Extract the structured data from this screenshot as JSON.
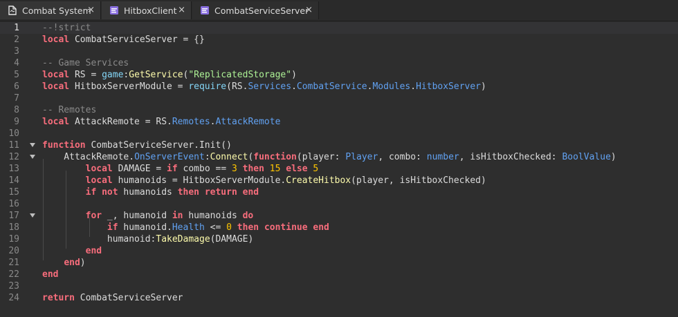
{
  "tabs": [
    {
      "label": "Combat System",
      "icon": "document-icon",
      "active": false,
      "close": "×"
    },
    {
      "label": "HitboxClient",
      "icon": "local-script-icon",
      "active": false,
      "close": "×"
    },
    {
      "label": "CombatServiceServer",
      "icon": "module-script-icon",
      "active": true,
      "close": "×"
    }
  ],
  "editor": {
    "current_line": 1,
    "lines": [
      {
        "n": "1",
        "tokens": [
          [
            "cm",
            "--!strict"
          ]
        ]
      },
      {
        "n": "2",
        "tokens": [
          [
            "kw",
            "local"
          ],
          [
            "",
            " CombatServiceServer = {}"
          ]
        ]
      },
      {
        "n": "3",
        "tokens": []
      },
      {
        "n": "4",
        "tokens": [
          [
            "cm",
            "-- Game Services"
          ]
        ]
      },
      {
        "n": "5",
        "tokens": [
          [
            "kw",
            "local"
          ],
          [
            "",
            " RS = "
          ],
          [
            "bi",
            "game"
          ],
          [
            "",
            ":"
          ],
          [
            "mt",
            "GetService"
          ],
          [
            "",
            "("
          ],
          [
            "st",
            "\"ReplicatedStorage\""
          ],
          [
            "",
            ")"
          ]
        ]
      },
      {
        "n": "6",
        "tokens": [
          [
            "kw",
            "local"
          ],
          [
            "",
            " HitboxServerModule = "
          ],
          [
            "bi",
            "require"
          ],
          [
            "",
            "(RS."
          ],
          [
            "pr",
            "Services"
          ],
          [
            "",
            "."
          ],
          [
            "pr",
            "CombatService"
          ],
          [
            "",
            "."
          ],
          [
            "pr",
            "Modules"
          ],
          [
            "",
            "."
          ],
          [
            "pr",
            "HitboxServer"
          ],
          [
            "",
            ")"
          ]
        ]
      },
      {
        "n": "7",
        "tokens": []
      },
      {
        "n": "8",
        "tokens": [
          [
            "cm",
            "-- Remotes"
          ]
        ]
      },
      {
        "n": "9",
        "tokens": [
          [
            "kw",
            "local"
          ],
          [
            "",
            " AttackRemote = RS."
          ],
          [
            "pr",
            "Remotes"
          ],
          [
            "",
            "."
          ],
          [
            "pr",
            "AttackRemote"
          ]
        ]
      },
      {
        "n": "10",
        "tokens": []
      },
      {
        "n": "11",
        "fold": true,
        "tokens": [
          [
            "kw",
            "function"
          ],
          [
            "",
            " CombatServiceServer.Init()"
          ]
        ]
      },
      {
        "n": "12",
        "fold": true,
        "tokens": [
          [
            "",
            "    AttackRemote."
          ],
          [
            "pr",
            "OnServerEvent"
          ],
          [
            "",
            ":"
          ],
          [
            "mt",
            "Connect"
          ],
          [
            "",
            "("
          ],
          [
            "kw",
            "function"
          ],
          [
            "",
            "(player: "
          ],
          [
            "ty",
            "Player"
          ],
          [
            "",
            ", combo: "
          ],
          [
            "ty",
            "number"
          ],
          [
            "",
            ", isHitboxChecked: "
          ],
          [
            "ty",
            "BoolValue"
          ],
          [
            "",
            ")"
          ]
        ]
      },
      {
        "n": "13",
        "tokens": [
          [
            "",
            "        "
          ],
          [
            "kw",
            "local"
          ],
          [
            "",
            " DAMAGE = "
          ],
          [
            "kw",
            "if"
          ],
          [
            "",
            " combo == "
          ],
          [
            "nu",
            "3"
          ],
          [
            "",
            " "
          ],
          [
            "kw",
            "then"
          ],
          [
            "",
            " "
          ],
          [
            "nu",
            "15"
          ],
          [
            "",
            " "
          ],
          [
            "kw",
            "else"
          ],
          [
            "",
            " "
          ],
          [
            "nu",
            "5"
          ]
        ]
      },
      {
        "n": "14",
        "tokens": [
          [
            "",
            "        "
          ],
          [
            "kw",
            "local"
          ],
          [
            "",
            " humanoids = HitboxServerModule."
          ],
          [
            "mt",
            "CreateHitbox"
          ],
          [
            "",
            "(player, isHitboxChecked)"
          ]
        ]
      },
      {
        "n": "15",
        "tokens": [
          [
            "",
            "        "
          ],
          [
            "kw",
            "if"
          ],
          [
            "",
            " "
          ],
          [
            "kw",
            "not"
          ],
          [
            "",
            " humanoids "
          ],
          [
            "kw",
            "then"
          ],
          [
            "",
            " "
          ],
          [
            "kw",
            "return"
          ],
          [
            "",
            " "
          ],
          [
            "kw",
            "end"
          ]
        ]
      },
      {
        "n": "16",
        "tokens": []
      },
      {
        "n": "17",
        "fold": true,
        "tokens": [
          [
            "",
            "        "
          ],
          [
            "kw",
            "for"
          ],
          [
            "",
            " _, humanoid "
          ],
          [
            "kw",
            "in"
          ],
          [
            "",
            " humanoids "
          ],
          [
            "kw",
            "do"
          ]
        ]
      },
      {
        "n": "18",
        "tokens": [
          [
            "",
            "            "
          ],
          [
            "kw",
            "if"
          ],
          [
            "",
            " humanoid."
          ],
          [
            "pr",
            "Health"
          ],
          [
            "",
            " <= "
          ],
          [
            "nu",
            "0"
          ],
          [
            "",
            " "
          ],
          [
            "kw",
            "then"
          ],
          [
            "",
            " "
          ],
          [
            "kw",
            "continue"
          ],
          [
            "",
            " "
          ],
          [
            "kw",
            "end"
          ]
        ]
      },
      {
        "n": "19",
        "tokens": [
          [
            "",
            "            humanoid:"
          ],
          [
            "mt",
            "TakeDamage"
          ],
          [
            "",
            "(DAMAGE)"
          ]
        ]
      },
      {
        "n": "20",
        "tokens": [
          [
            "",
            "        "
          ],
          [
            "kw",
            "end"
          ]
        ]
      },
      {
        "n": "21",
        "tokens": [
          [
            "",
            "    "
          ],
          [
            "kw",
            "end"
          ],
          [
            "",
            ")"
          ]
        ]
      },
      {
        "n": "22",
        "tokens": [
          [
            "kw",
            "end"
          ]
        ]
      },
      {
        "n": "23",
        "tokens": []
      },
      {
        "n": "24",
        "tokens": [
          [
            "kw",
            "return"
          ],
          [
            "",
            " CombatServiceServer"
          ]
        ]
      }
    ]
  }
}
